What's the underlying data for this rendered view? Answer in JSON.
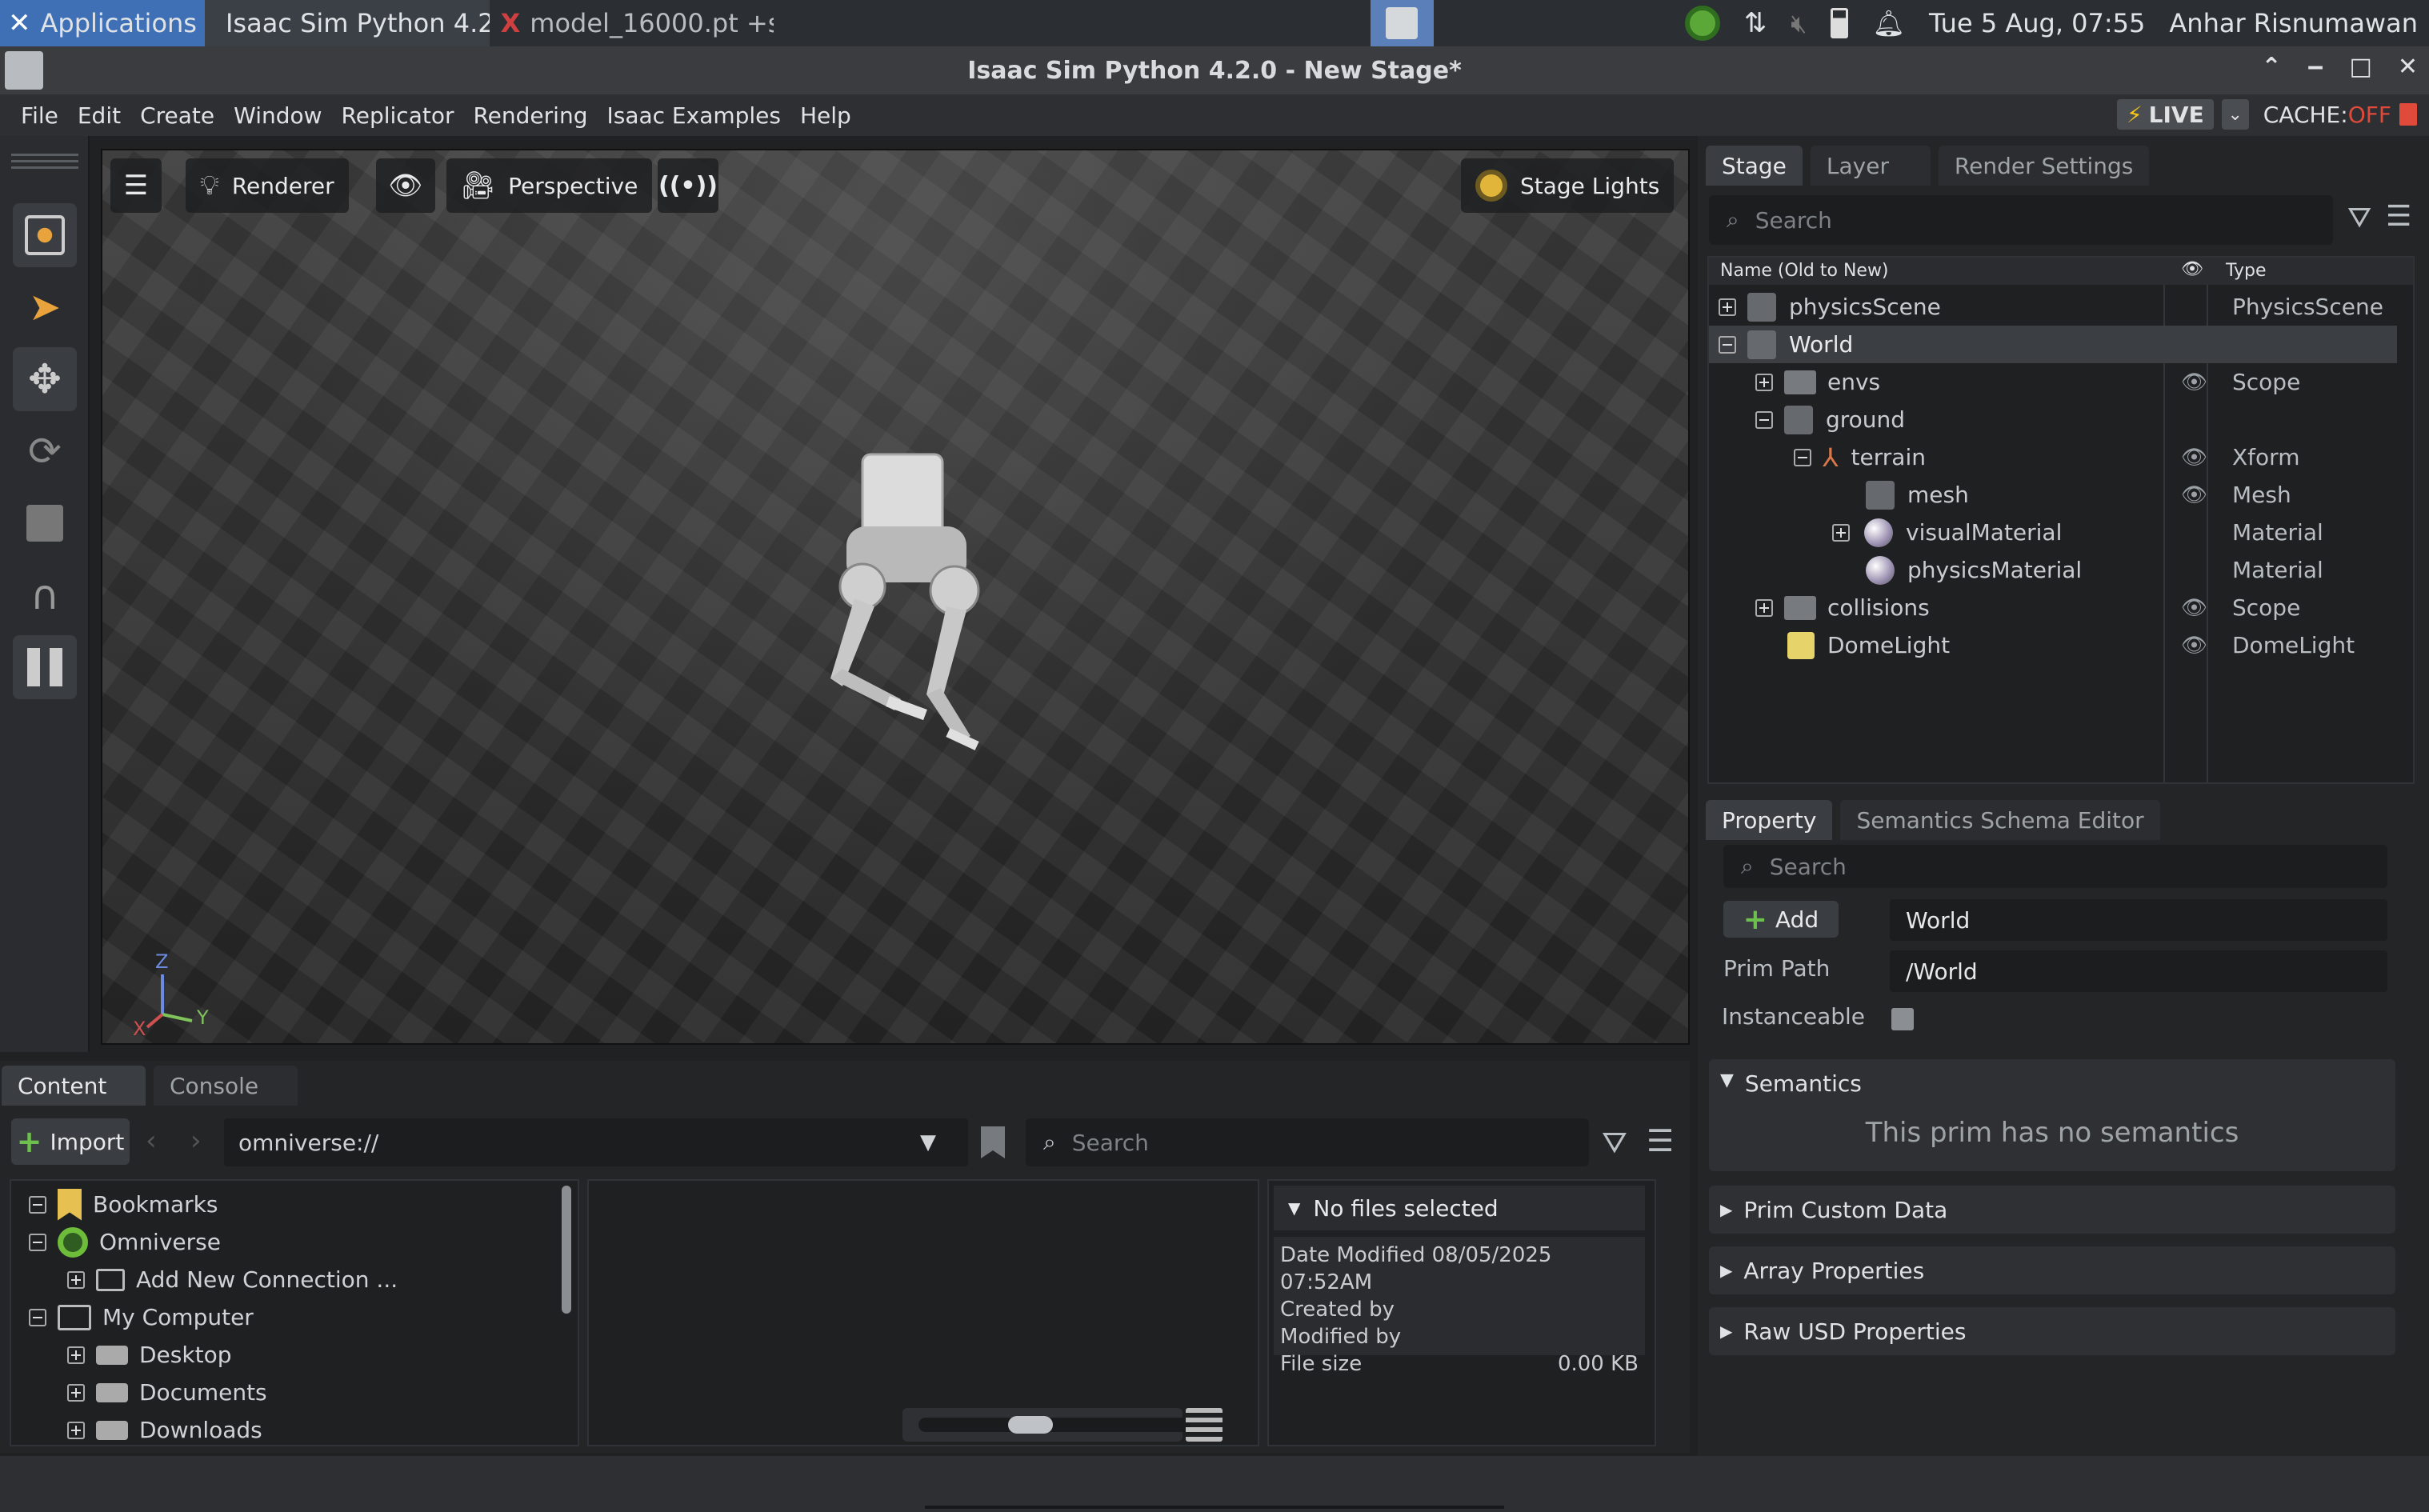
{
  "taskbar": {
    "apps_label": "Applications",
    "window1": "Isaac Sim Python 4.2.0 -...",
    "window2": "model_16000.pt +simul...",
    "clock": "Tue  5 Aug, 07:55",
    "user": "Anhar Risnumawan"
  },
  "window": {
    "title": "Isaac Sim Python 4.2.0 - New Stage*"
  },
  "menu": [
    "File",
    "Edit",
    "Create",
    "Window",
    "Replicator",
    "Rendering",
    "Isaac Examples",
    "Help"
  ],
  "live": {
    "label": "LIVE",
    "cache_label": "CACHE:",
    "cache_state": "OFF"
  },
  "viewport": {
    "renderer": "Renderer",
    "camera": "Perspective",
    "lights": "Stage Lights",
    "axis_z": "Z",
    "axis_x": "X",
    "axis_y": "Y"
  },
  "stage": {
    "tabs": [
      "Stage",
      "Layer",
      "Render Settings"
    ],
    "search_placeholder": "Search",
    "col_name": "Name (Old to New)",
    "col_type": "Type",
    "rows": [
      {
        "name": "physicsScene",
        "type": "PhysicsScene"
      },
      {
        "name": "World",
        "type": ""
      },
      {
        "name": "envs",
        "type": "Scope"
      },
      {
        "name": "ground",
        "type": ""
      },
      {
        "name": "terrain",
        "type": "Xform"
      },
      {
        "name": "mesh",
        "type": "Mesh"
      },
      {
        "name": "visualMaterial",
        "type": "Material"
      },
      {
        "name": "physicsMaterial",
        "type": "Material"
      },
      {
        "name": "collisions",
        "type": "Scope"
      },
      {
        "name": "DomeLight",
        "type": "DomeLight"
      }
    ]
  },
  "property": {
    "tabs": [
      "Property",
      "Semantics Schema Editor"
    ],
    "search_placeholder": "Search",
    "add_label": "Add",
    "name_value": "World",
    "prim_path_label": "Prim Path",
    "prim_path_value": "/World",
    "instanceable_label": "Instanceable",
    "sections": {
      "semantics": "Semantics",
      "no_semantics": "This prim has no semantics",
      "custom": "Prim Custom Data",
      "array": "Array Properties",
      "raw": "Raw USD Properties"
    }
  },
  "content": {
    "tabs": [
      "Content",
      "Console"
    ],
    "import_label": "Import",
    "path": "omniverse://",
    "search_placeholder": "Search",
    "tree": [
      "Bookmarks",
      "Omniverse",
      "Add New Connection ...",
      "My Computer",
      "Desktop",
      "Documents",
      "Downloads"
    ],
    "details": {
      "header": "No files selected",
      "date_modified": "Date Modified 08/05/2025 07:52AM",
      "created_by": "Created by",
      "modified_by": "Modified by",
      "file_size_label": "File size",
      "file_size_value": "0.00 KB"
    }
  }
}
